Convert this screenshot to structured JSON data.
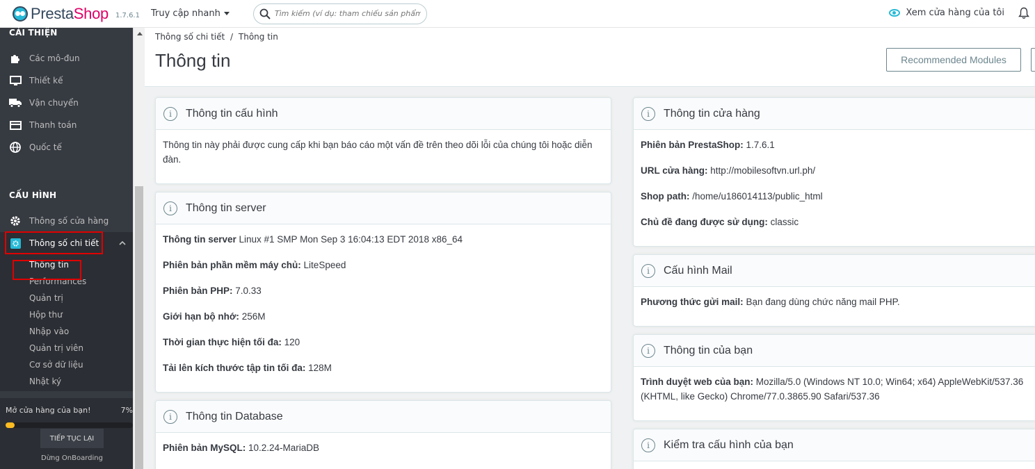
{
  "topbar": {
    "logo_presta": "Presta",
    "logo_shop": "Shop",
    "version": "1.7.6.1",
    "quick_access": "Truy cập nhanh",
    "search_placeholder": "Tìm kiếm (ví dụ: tham chiếu sản phẩm, t",
    "view_shop": "Xem cửa hàng của tôi"
  },
  "sidebar": {
    "section_improve": "CẢI THIỆN",
    "improve_items": [
      "Các mô-đun",
      "Thiết kế",
      "Vận chuyển",
      "Thanh toán",
      "Quốc tế"
    ],
    "section_config": "CẤU HÌNH",
    "config_items": [
      "Thông số cửa hàng",
      "Thông số chi tiết"
    ],
    "sub_items": [
      "Thông tin",
      "Performances",
      "Quản trị",
      "Hộp thư",
      "Nhập vào",
      "Quản trị viên",
      "Cơ sở dữ liệu",
      "Nhật ký"
    ],
    "onboarding": {
      "text": "Mở cửa hàng của bạn!",
      "percent": "7%",
      "progress": 0.07,
      "continue": "TIẾP TỤC LẠI",
      "stop": "Dừng OnBoarding"
    }
  },
  "header": {
    "breadcrumb_1": "Thông số chi tiết",
    "breadcrumb_sep": "/",
    "breadcrumb_2": "Thông tin",
    "title": "Thông tin",
    "recommended": "Recommended Modules"
  },
  "cards": {
    "config": {
      "title": "Thông tin cấu hình",
      "text": "Thông tin này phải được cung cấp khi bạn báo cáo một vấn đề trên theo dõi lỗi của chúng tôi hoặc diễn đàn."
    },
    "server": {
      "title": "Thông tin server",
      "rows": [
        {
          "label": "Thông tin server",
          "value": " Linux #1 SMP Mon Sep 3 16:04:13 EDT 2018 x86_64"
        },
        {
          "label": "Phiên bản phần mềm máy chủ:",
          "value": " LiteSpeed"
        },
        {
          "label": "Phiên bản PHP:",
          "value": " 7.0.33"
        },
        {
          "label": "Giới hạn bộ nhớ:",
          "value": " 256M"
        },
        {
          "label": "Thời gian thực hiện tối đa:",
          "value": " 120"
        },
        {
          "label": "Tải lên kích thước tập tin tối đa:",
          "value": " 128M"
        }
      ]
    },
    "database": {
      "title": "Thông tin Database",
      "rows": [
        {
          "label": "Phiên bản MySQL:",
          "value": " 10.2.24-MariaDB"
        }
      ]
    },
    "shop": {
      "title": "Thông tin cửa hàng",
      "rows": [
        {
          "label": "Phiên bản PrestaShop:",
          "value": " 1.7.6.1"
        },
        {
          "label": "URL cửa hàng:",
          "value": " http://mobilesoftvn.url.ph/"
        },
        {
          "label": "Shop path:",
          "value": " /home/u186014113/public_html"
        },
        {
          "label": "Chủ đề đang được sử dụng:",
          "value": " classic"
        }
      ]
    },
    "mail": {
      "title": "Cấu hình Mail",
      "rows": [
        {
          "label": "Phương thức gửi mail:",
          "value": " Bạn đang dùng chức năng mail PHP."
        }
      ]
    },
    "you": {
      "title": "Thông tin của bạn",
      "rows": [
        {
          "label": "Trình duyệt web của bạn:",
          "value": " Mozilla/5.0 (Windows NT 10.0; Win64; x64) AppleWebKit/537.36 (KHTML, like Gecko) Chrome/77.0.3865.90 Safari/537.36"
        }
      ]
    },
    "check": {
      "title": "Kiểm tra cấu hình của bạn"
    }
  }
}
